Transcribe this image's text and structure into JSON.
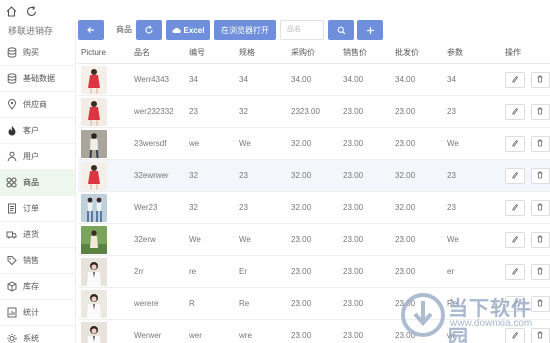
{
  "app": {
    "title": "移联进销存"
  },
  "sidebar": {
    "items": [
      {
        "label": "购买",
        "icon": "db-icon"
      },
      {
        "label": "基础数据",
        "icon": "db-icon"
      },
      {
        "label": "供应商",
        "icon": "location-icon"
      },
      {
        "label": "客户",
        "icon": "fire-icon"
      },
      {
        "label": "用户",
        "icon": "person-icon"
      },
      {
        "label": "商品",
        "icon": "grid-icon",
        "active": true
      },
      {
        "label": "订单",
        "icon": "order-icon"
      },
      {
        "label": "进货",
        "icon": "truck-icon"
      },
      {
        "label": "销售",
        "icon": "tag-icon"
      },
      {
        "label": "库存",
        "icon": "box-icon"
      },
      {
        "label": "统计",
        "icon": "chart-icon"
      },
      {
        "label": "系统",
        "icon": "gear-icon"
      }
    ]
  },
  "toolbar": {
    "back_icon": "arrow-left-icon",
    "label": "商品",
    "refresh_icon": "refresh-icon",
    "excel_label": "Excel",
    "browser_label": "在浏览器打开",
    "search_placeholder": "品名",
    "search_icon": "search-icon",
    "add_icon": "plus-icon"
  },
  "table": {
    "headers": {
      "picture": "Picture",
      "name": "品名",
      "code": "编号",
      "spec": "规格",
      "buy": "采购价",
      "sell": "销售价",
      "whole": "批发价",
      "param": "参数",
      "op": "操作"
    },
    "rows": [
      {
        "name": "Werr4343",
        "code": "34",
        "spec": "34",
        "buy": "34.00",
        "sell": "34.00",
        "whole": "34.00",
        "param": "34",
        "img": "red"
      },
      {
        "name": "wer232332",
        "code": "23",
        "spec": "32",
        "buy": "2323.00",
        "sell": "23.00",
        "whole": "23.00",
        "param": "23",
        "img": "red2"
      },
      {
        "name": "23wersdf",
        "code": "we",
        "spec": "We",
        "buy": "32.00",
        "sell": "23.00",
        "whole": "23.00",
        "param": "We",
        "img": "street"
      },
      {
        "name": "32ewrwer",
        "code": "32",
        "spec": "23",
        "buy": "32.00",
        "sell": "23.00",
        "whole": "32.00",
        "param": "23",
        "img": "red",
        "highlight": true
      },
      {
        "name": "Wer23",
        "code": "32",
        "spec": "23",
        "buy": "32.00",
        "sell": "23.00",
        "whole": "32.00",
        "param": "23",
        "img": "jeans"
      },
      {
        "name": "32erw",
        "code": "We",
        "spec": "We",
        "buy": "23.00",
        "sell": "23.00",
        "whole": "23.00",
        "param": "We",
        "img": "green"
      },
      {
        "name": "2rr",
        "code": "re",
        "spec": "Er",
        "buy": "23.00",
        "sell": "23.00",
        "whole": "23.00",
        "param": "er",
        "img": "girl"
      },
      {
        "name": "werere",
        "code": "R",
        "spec": "Re",
        "buy": "23.00",
        "sell": "23.00",
        "whole": "23.00",
        "param": "Re",
        "img": "girl2"
      },
      {
        "name": "Werwer",
        "code": "wer",
        "spec": "wre",
        "buy": "23.00",
        "sell": "23.00",
        "whole": "23.00",
        "param": "wr",
        "img": "girl"
      }
    ]
  },
  "watermark": {
    "title": "当下软件园",
    "url": "www.downxia.com"
  }
}
